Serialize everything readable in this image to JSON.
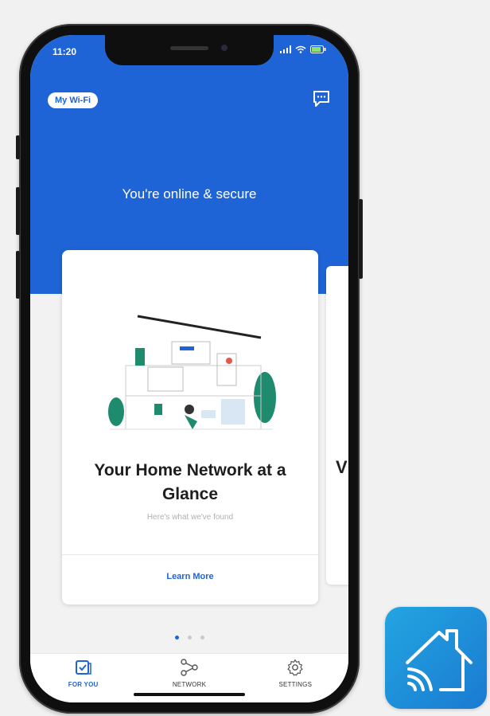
{
  "status_bar": {
    "time": "11:20"
  },
  "header": {
    "badge_label": "My Wi-Fi",
    "chat_icon": "chat-bubble-icon",
    "headline": "You're online & secure"
  },
  "card": {
    "title": "Your Home Network at a Glance",
    "subtitle": "Here's what we've found",
    "link_label": "Learn More"
  },
  "next_card": {
    "peek_letter": "V"
  },
  "pagination": {
    "count": 3,
    "active_index": 0
  },
  "tabs": [
    {
      "label": "FOR YOU",
      "icon": "for-you-icon",
      "active": true
    },
    {
      "label": "NETWORK",
      "icon": "network-icon",
      "active": false
    },
    {
      "label": "SETTINGS",
      "icon": "gear-icon",
      "active": false
    }
  ],
  "app_icon": {
    "icon": "home-wifi-icon"
  },
  "colors": {
    "brand_blue": "#1f64d6",
    "app_icon_gradient_start": "#23a5e2",
    "app_icon_gradient_end": "#1a7ad0",
    "illustration_accent": "#1e8a6e"
  }
}
